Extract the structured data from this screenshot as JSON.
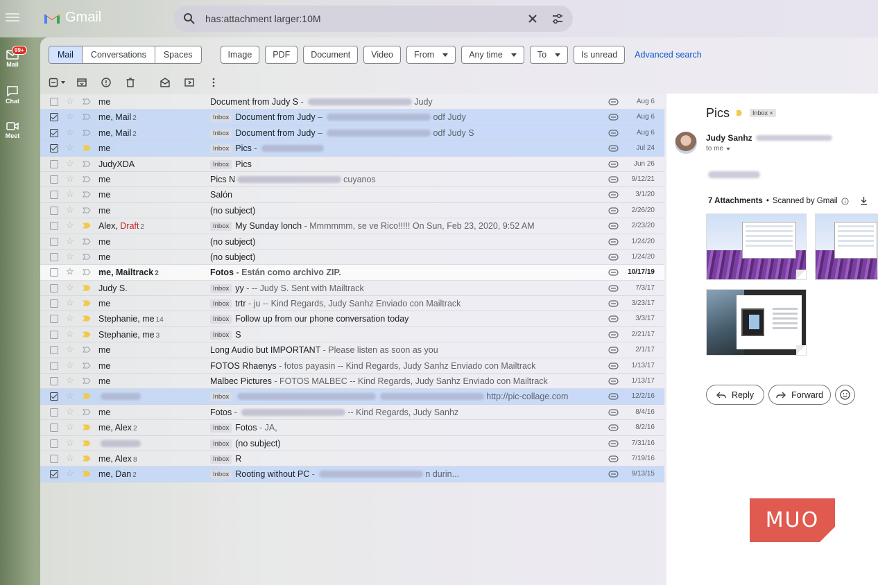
{
  "app": {
    "name": "Gmail"
  },
  "search": {
    "query": "has:attachment larger:10M"
  },
  "rail": {
    "mail_label": "Mail",
    "mail_badge": "99+",
    "chat_label": "Chat",
    "meet_label": "Meet"
  },
  "filters": {
    "segments": [
      "Mail",
      "Conversations",
      "Spaces"
    ],
    "chips": [
      "Image",
      "PDF",
      "Document",
      "Video"
    ],
    "dropdowns": [
      "From",
      "Any time",
      "To"
    ],
    "is_unread": "Is unread",
    "advanced": "Advanced search"
  },
  "emails": [
    {
      "sender": "me",
      "count": "",
      "draft": "",
      "label": "",
      "subject": "Document from Judy S",
      "snippet": " - ",
      "tail": "Judy",
      "date": "Aug 6",
      "checked": false,
      "important": false,
      "bold": false
    },
    {
      "sender": "me, Mail",
      "count": "2",
      "draft": "",
      "label": "Inbox",
      "subject": "Document from Judy",
      "snippet": " – ",
      "tail": "odf Judy",
      "date": "Aug 6",
      "checked": true,
      "important": false,
      "bold": false
    },
    {
      "sender": "me, Mail",
      "count": "2",
      "draft": "",
      "label": "Inbox",
      "subject": "Document from Judy",
      "snippet": " – ",
      "tail": "odf Judy S",
      "date": "Aug 6",
      "checked": true,
      "important": false,
      "bold": false
    },
    {
      "sender": "me",
      "count": "",
      "draft": "",
      "label": "Inbox",
      "subject": "Pics",
      "snippet": " - ",
      "tail": "",
      "date": "Jul 24",
      "checked": true,
      "important": true,
      "bold": false
    },
    {
      "sender": "JudyXDA",
      "count": "",
      "draft": "",
      "label": "Inbox",
      "subject": "Pics",
      "snippet": "",
      "tail": "",
      "date": "Jun 26",
      "checked": false,
      "important": false,
      "bold": false
    },
    {
      "sender": "me",
      "count": "",
      "draft": "",
      "label": "",
      "subject": "Pics N",
      "snippet": "",
      "tail": "cuyanos",
      "date": "9/12/21",
      "checked": false,
      "important": false,
      "bold": false
    },
    {
      "sender": "me",
      "count": "",
      "draft": "",
      "label": "",
      "subject": "Salón",
      "snippet": "",
      "tail": "",
      "date": "3/1/20",
      "checked": false,
      "important": false,
      "bold": false
    },
    {
      "sender": "me",
      "count": "",
      "draft": "",
      "label": "",
      "subject": "(no subject)",
      "snippet": "",
      "tail": "",
      "date": "2/26/20",
      "checked": false,
      "important": false,
      "bold": false
    },
    {
      "sender": "Alex,",
      "count": "2",
      "draft": "Draft",
      "label": "Inbox",
      "subject": "My Sunday lonch",
      "snippet": " - Mmmmmm, se ve Rico!!!!! On Sun, Feb 23, 2020, 9:52 AM",
      "tail": "",
      "date": "2/23/20",
      "checked": false,
      "important": true,
      "bold": false
    },
    {
      "sender": "me",
      "count": "",
      "draft": "",
      "label": "",
      "subject": "(no subject)",
      "snippet": "",
      "tail": "",
      "date": "1/24/20",
      "checked": false,
      "important": false,
      "bold": false
    },
    {
      "sender": "me",
      "count": "",
      "draft": "",
      "label": "",
      "subject": "(no subject)",
      "snippet": "",
      "tail": "",
      "date": "1/24/20",
      "checked": false,
      "important": false,
      "bold": false
    },
    {
      "sender": "me, Mailtrack",
      "count": "2",
      "draft": "",
      "label": "",
      "subject": "Fotos",
      "snippet": " - Están como archivo ZIP.",
      "tail": "",
      "date": "10/17/19",
      "checked": false,
      "important": false,
      "bold": true
    },
    {
      "sender": "Judy S.",
      "count": "",
      "draft": "",
      "label": "Inbox",
      "subject": "yy",
      "snippet": " - -- Judy S. Sent with Mailtrack",
      "tail": "",
      "date": "7/3/17",
      "checked": false,
      "important": true,
      "bold": false
    },
    {
      "sender": "me",
      "count": "",
      "draft": "",
      "label": "Inbox",
      "subject": "trtr",
      "snippet": " - ju -- Kind Regards, Judy Sanhz Enviado con Mailtrack",
      "tail": "",
      "date": "3/23/17",
      "checked": false,
      "important": true,
      "bold": false
    },
    {
      "sender": "Stephanie, me",
      "count": "14",
      "draft": "",
      "label": "Inbox",
      "subject": "Follow up from our phone conversation today",
      "snippet": "",
      "tail": "",
      "date": "3/3/17",
      "checked": false,
      "important": true,
      "bold": false
    },
    {
      "sender": "Stephanie, me",
      "count": "3",
      "draft": "",
      "label": "Inbox",
      "subject": "S",
      "snippet": "",
      "tail": "",
      "date": "2/21/17",
      "checked": false,
      "important": true,
      "bold": false
    },
    {
      "sender": "me",
      "count": "",
      "draft": "",
      "label": "",
      "subject": "Long Audio but IMPORTANT",
      "snippet": " - Please listen as soon as you",
      "tail": "",
      "date": "2/1/17",
      "checked": false,
      "important": false,
      "bold": false
    },
    {
      "sender": "me",
      "count": "",
      "draft": "",
      "label": "",
      "subject": "FOTOS Rhaenys",
      "snippet": " - fotos payasin -- Kind Regards, Judy Sanhz Enviado con Mailtrack",
      "tail": "",
      "date": "1/13/17",
      "checked": false,
      "important": false,
      "bold": false
    },
    {
      "sender": "me",
      "count": "",
      "draft": "",
      "label": "",
      "subject": "Malbec Pictures",
      "snippet": " - FOTOS MALBEC -- Kind Regards, Judy Sanhz Enviado con Mailtrack",
      "tail": "",
      "date": "1/13/17",
      "checked": false,
      "important": false,
      "bold": false
    },
    {
      "sender": "",
      "count": "",
      "draft": "",
      "label": "Inbox",
      "subject": "",
      "snippet": "",
      "tail": "http://pic-collage.com",
      "date": "12/2/16",
      "checked": true,
      "important": true,
      "bold": false
    },
    {
      "sender": "me",
      "count": "",
      "draft": "",
      "label": "",
      "subject": "Fotos",
      "snippet": " - ",
      "tail": "-- Kind Regards, Judy Sanhz",
      "date": "8/4/16",
      "checked": false,
      "important": false,
      "bold": false
    },
    {
      "sender": "me, Alex",
      "count": "2",
      "draft": "",
      "label": "Inbox",
      "subject": "Fotos",
      "snippet": " - JA,",
      "tail": "",
      "date": "8/2/16",
      "checked": false,
      "important": true,
      "bold": false
    },
    {
      "sender": "",
      "count": "",
      "draft": "",
      "label": "Inbox",
      "subject": "(no subject)",
      "snippet": "",
      "tail": "",
      "date": "7/31/16",
      "checked": false,
      "important": true,
      "bold": false
    },
    {
      "sender": "me, Alex",
      "count": "8",
      "draft": "",
      "label": "Inbox",
      "subject": "R",
      "snippet": "",
      "tail": "",
      "date": "7/19/16",
      "checked": false,
      "important": true,
      "bold": false
    },
    {
      "sender": "me, Dan",
      "count": "2",
      "draft": "",
      "label": "Inbox",
      "subject": "Rooting without PC",
      "snippet": " - ",
      "tail": "n durin...",
      "date": "9/13/15",
      "checked": true,
      "important": true,
      "bold": false
    }
  ],
  "reading": {
    "title": "Pics",
    "inbox_tag": "Inbox ×",
    "from_name": "Judy Sanhz",
    "to": "to me",
    "attachments_count": "7 Attachments",
    "dot": "•",
    "scanned": "Scanned by Gmail",
    "reply": "Reply",
    "forward": "Forward"
  },
  "watermark": "MUO",
  "colors": {
    "accent": "#0b57d0",
    "selected_row": "#c2d7f8",
    "important": "#f2c94c",
    "badge": "#d93025"
  }
}
